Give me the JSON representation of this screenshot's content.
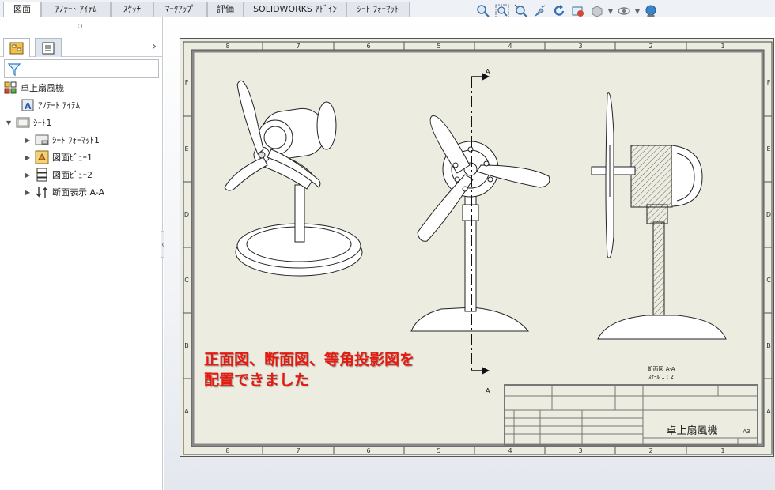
{
  "tabs": [
    {
      "label": "図面",
      "active": true
    },
    {
      "label": "ｱﾉﾃｰﾄ ｱｲﾃﾑ",
      "active": false
    },
    {
      "label": "ｽｹｯﾁ",
      "active": false
    },
    {
      "label": "ﾏｰｸｱｯﾌﾟ",
      "active": false
    },
    {
      "label": "評価",
      "active": false
    },
    {
      "label": "SOLIDWORKS ｱﾄﾞｲﾝ",
      "active": false
    },
    {
      "label": "ｼｰﾄ ﾌｫｰﾏｯﾄ",
      "active": false
    }
  ],
  "view_toolbar": [
    "zoom-to-fit-icon",
    "zoom-to-area-icon",
    "zoom-in-out-icon",
    "pan-icon",
    "rotate-icon",
    "view-settings-icon",
    "display-style-icon",
    "hide-show-icon",
    "appearance-icon"
  ],
  "panel": {
    "tabs": [
      "feature-manager-icon",
      "property-manager-icon"
    ],
    "tree": [
      {
        "label": "卓上扇風機",
        "icon": "drawing-icon",
        "level": 0,
        "arrow": ""
      },
      {
        "label": "ｱﾉﾃｰﾄ ｱｲﾃﾑ",
        "icon": "annotation-icon",
        "level": 1,
        "arrow": ""
      },
      {
        "label": "ｼｰﾄ1",
        "icon": "sheet-icon",
        "level": 0,
        "arrow": "▼"
      },
      {
        "label": "ｼｰﾄ ﾌｫｰﾏｯﾄ1",
        "icon": "sheet-format-icon",
        "level": 2,
        "arrow": "▶"
      },
      {
        "label": "図面ﾋﾞｭｰ1",
        "icon": "drawing-view-icon",
        "level": 2,
        "arrow": "▶"
      },
      {
        "label": "図面ﾋﾞｭｰ2",
        "icon": "drawing-view2-icon",
        "level": 2,
        "arrow": "▶"
      },
      {
        "label": "断面表示 A-A",
        "icon": "section-view-icon",
        "level": 2,
        "arrow": "▶"
      }
    ]
  },
  "sheet": {
    "columns": [
      "8",
      "7",
      "6",
      "5",
      "4",
      "3",
      "2",
      "1"
    ],
    "rows": [
      "F",
      "E",
      "D",
      "C",
      "B",
      "A"
    ],
    "section_label": "A",
    "section_view_title": "断面図 A-A",
    "section_view_scale": "ｽｹｰﾙ 1 : 2",
    "title_block_name": "卓上扇風機",
    "title_block_size": "A3"
  },
  "annotation": {
    "line1": "正面図、断面図、等角投影図を",
    "line2": "配置できました"
  },
  "colors": {
    "annotation": "#e8190f",
    "sheet_bg": "#ecece0",
    "line": "#333333"
  }
}
